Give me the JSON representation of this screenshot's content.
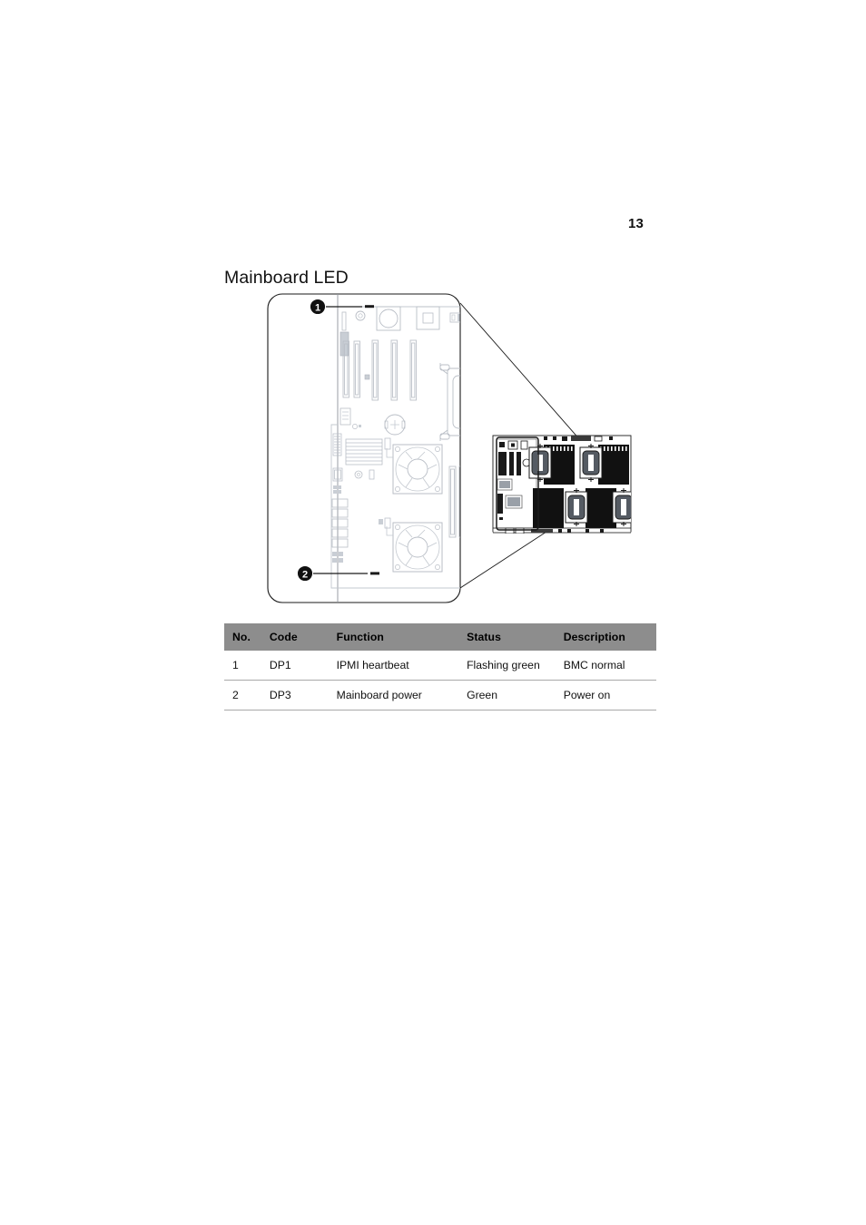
{
  "page": {
    "number": "13"
  },
  "section": {
    "title": "Mainboard LED"
  },
  "figure": {
    "name": "mainboard-led-callout-diagram",
    "callouts": [
      {
        "id": "1",
        "label": "1"
      },
      {
        "id": "2",
        "label": "2"
      }
    ]
  },
  "table": {
    "headers": [
      "No.",
      "Code",
      "Function",
      "Status",
      "Description"
    ],
    "rows": [
      {
        "no": "1",
        "code": "DP1",
        "function": "IPMI heartbeat",
        "status": "Flashing green",
        "description": "BMC normal"
      },
      {
        "no": "2",
        "code": "DP3",
        "function": "Mainboard power",
        "status": "Green",
        "description": "Power on"
      }
    ]
  },
  "colors": {
    "header_bg": "#8d8d8d",
    "rule": "#a8a8a8",
    "text": "#111111",
    "line_art": "#b9bec6",
    "line_art_dark": "#1a1a1a"
  }
}
